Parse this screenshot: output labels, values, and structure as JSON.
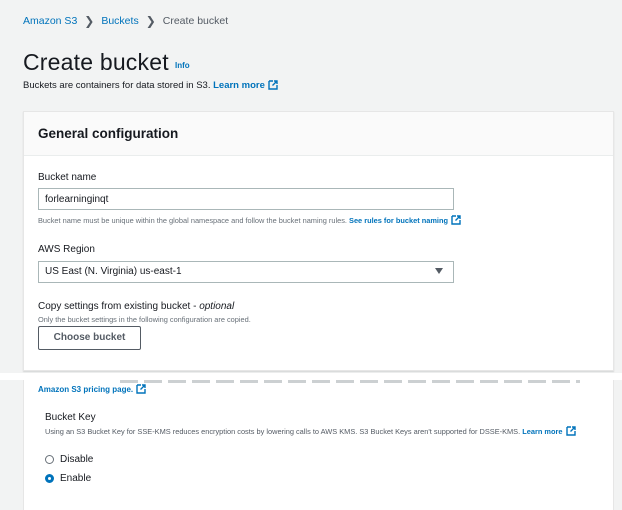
{
  "breadcrumb": {
    "items": [
      "Amazon S3",
      "Buckets",
      "Create bucket"
    ]
  },
  "page": {
    "title": "Create bucket",
    "info_link": "Info",
    "description": "Buckets are containers for data stored in S3.",
    "learn_more": "Learn more"
  },
  "general": {
    "heading": "General configuration",
    "bucket_name_label": "Bucket name",
    "bucket_name_value": "forlearninginqt",
    "bucket_name_hint": "Bucket name must be unique within the global namespace and follow the bucket naming rules.",
    "bucket_name_rules_link": "See rules for bucket naming",
    "region_label": "AWS Region",
    "region_value": "US East (N. Virginia) us-east-1",
    "copy_label": "Copy settings from existing bucket",
    "copy_optional": "optional",
    "copy_hint": "Only the bucket settings in the following configuration are copied.",
    "choose_button": "Choose bucket"
  },
  "encryption": {
    "pricing_link": "Amazon S3 pricing page.",
    "bucket_key_label": "Bucket Key",
    "bucket_key_desc": "Using an S3 Bucket Key for SSE-KMS reduces encryption costs by lowering calls to AWS KMS. S3 Bucket Keys aren't supported for DSSE-KMS.",
    "learn_more": "Learn more",
    "options": [
      {
        "label": "Disable",
        "selected": false
      },
      {
        "label": "Enable",
        "selected": true
      }
    ]
  },
  "colors": {
    "link": "#0073bb",
    "background": "#f2f3f3",
    "panel": "#ffffff",
    "radio_selected": "#0073bb"
  },
  "icons": [
    "chevron-right-icon",
    "external-link-icon",
    "dropdown-caret-icon",
    "radio-icon"
  ]
}
